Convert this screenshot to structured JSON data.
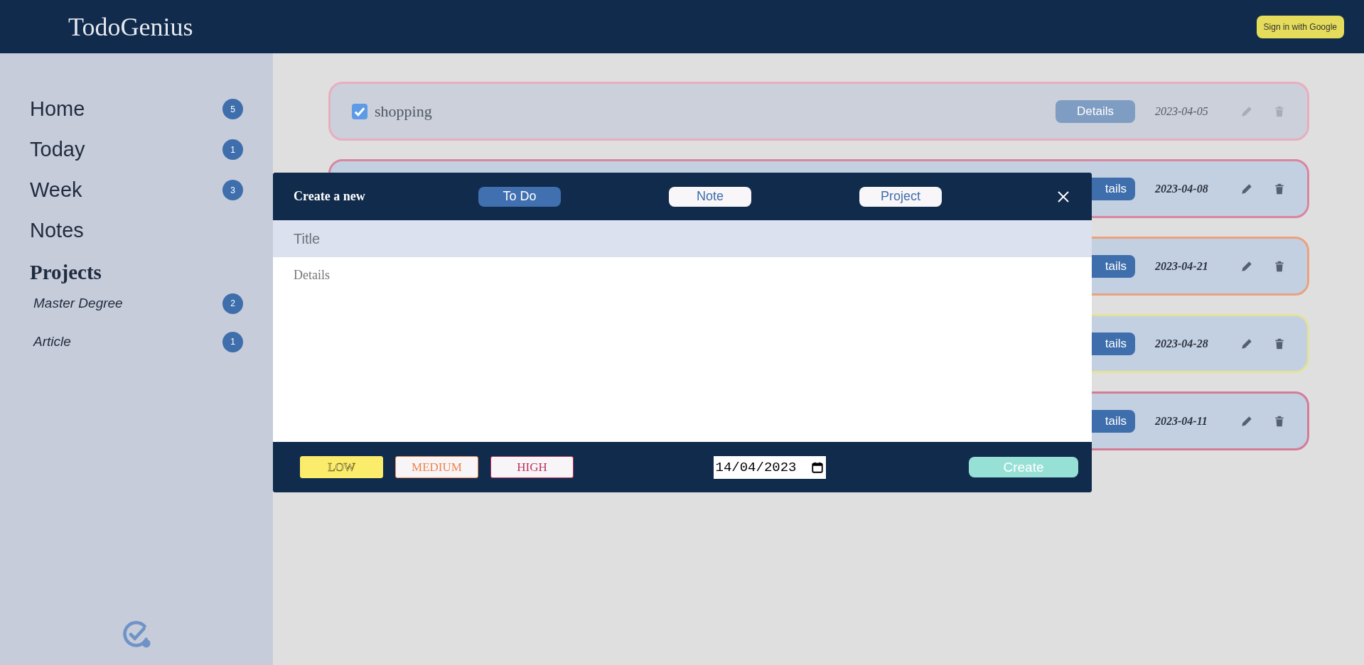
{
  "header": {
    "logo": "TodoGenius",
    "sign_in": "Sign in with Google"
  },
  "sidebar": {
    "items": [
      {
        "label": "Home",
        "count": "5"
      },
      {
        "label": "Today",
        "count": "1"
      },
      {
        "label": "Week",
        "count": "3"
      },
      {
        "label": "Notes"
      }
    ],
    "projects_heading": "Projects",
    "projects": [
      {
        "label": "Master Degree",
        "count": "2"
      },
      {
        "label": "Article",
        "count": "1"
      }
    ]
  },
  "tasks": [
    {
      "title": "shopping",
      "done": true,
      "details": "Details",
      "date": "2023-04-05",
      "color": "#e9aebe"
    },
    {
      "done": false,
      "details": "tails",
      "date": "2023-04-08",
      "color": "#d9869e"
    },
    {
      "done": false,
      "details": "tails",
      "date": "2023-04-21",
      "color": "#eaa27e"
    },
    {
      "done": false,
      "details": "tails",
      "date": "2023-04-28",
      "color": "#e4e29a"
    },
    {
      "done": false,
      "details": "tails",
      "date": "2023-04-11",
      "color": "#d47c96"
    }
  ],
  "modal": {
    "heading": "Create a new",
    "tabs": [
      {
        "label": "To Do",
        "selected": true
      },
      {
        "label": "Note",
        "selected": false
      },
      {
        "label": "Project",
        "selected": false
      }
    ],
    "title_placeholder": "Title",
    "details_placeholder": "Details",
    "priorities": [
      {
        "label": "LOW",
        "selected": true,
        "color": "#fbec6b"
      },
      {
        "label": "MEDIUM",
        "selected": false,
        "color": "#f0844a"
      },
      {
        "label": "HIGH",
        "selected": false,
        "color": "#c0305a"
      }
    ],
    "date": "14/04/2023",
    "create": "Create"
  }
}
